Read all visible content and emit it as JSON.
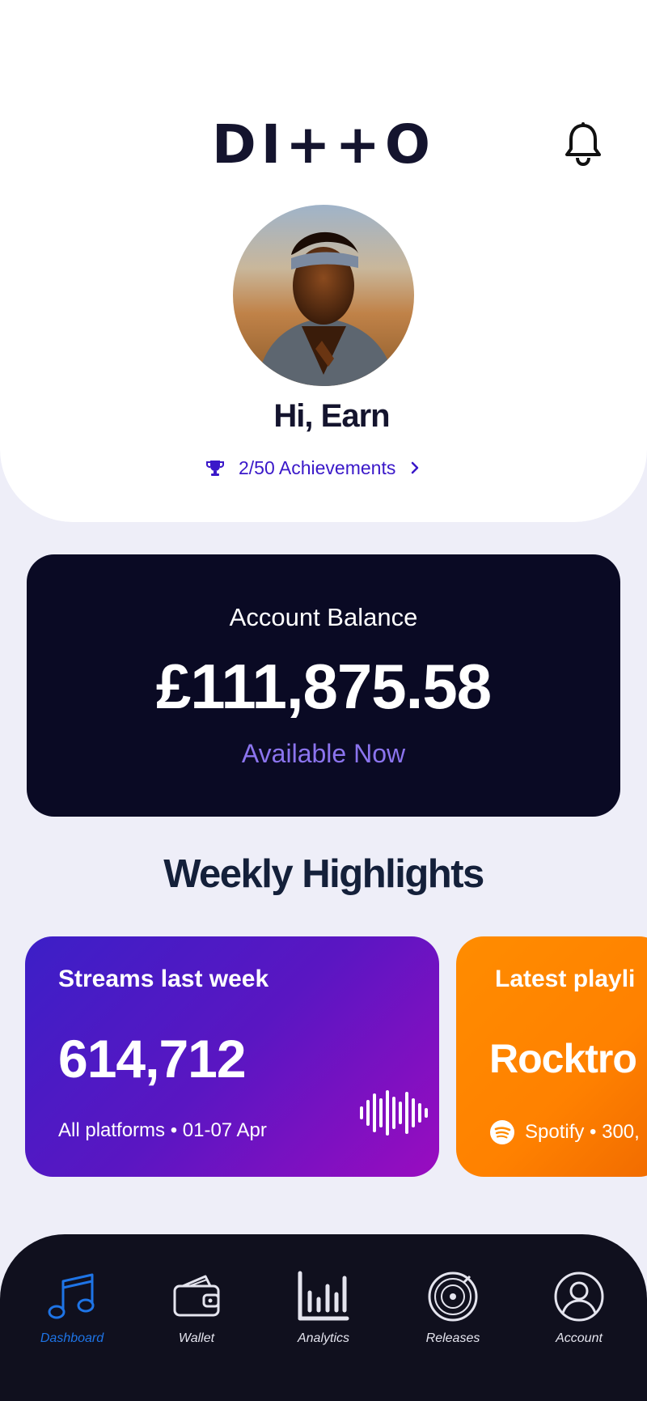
{
  "header": {
    "logo_text": "DI++O",
    "greeting": "Hi, Earn",
    "achievements_label": "2/50 Achievements",
    "accent": "#3a18c9"
  },
  "balance": {
    "label": "Account Balance",
    "amount": "£111,875.58",
    "status": "Available Now"
  },
  "highlights": {
    "title": "Weekly Highlights",
    "cards": [
      {
        "title": "Streams last week",
        "value": "614,712",
        "sub": "All platforms • 01-07 Apr"
      },
      {
        "title": "Latest playli",
        "value": "Rocktro",
        "sub": "Spotify • 300,"
      }
    ]
  },
  "nav": {
    "items": [
      {
        "label": "Dashboard",
        "icon": "music-note-icon",
        "active": true
      },
      {
        "label": "Wallet",
        "icon": "wallet-icon",
        "active": false
      },
      {
        "label": "Analytics",
        "icon": "bar-chart-icon",
        "active": false
      },
      {
        "label": "Releases",
        "icon": "vinyl-record-icon",
        "active": false
      },
      {
        "label": "Account",
        "icon": "user-icon",
        "active": false
      }
    ],
    "active_color": "#1e74e6"
  }
}
